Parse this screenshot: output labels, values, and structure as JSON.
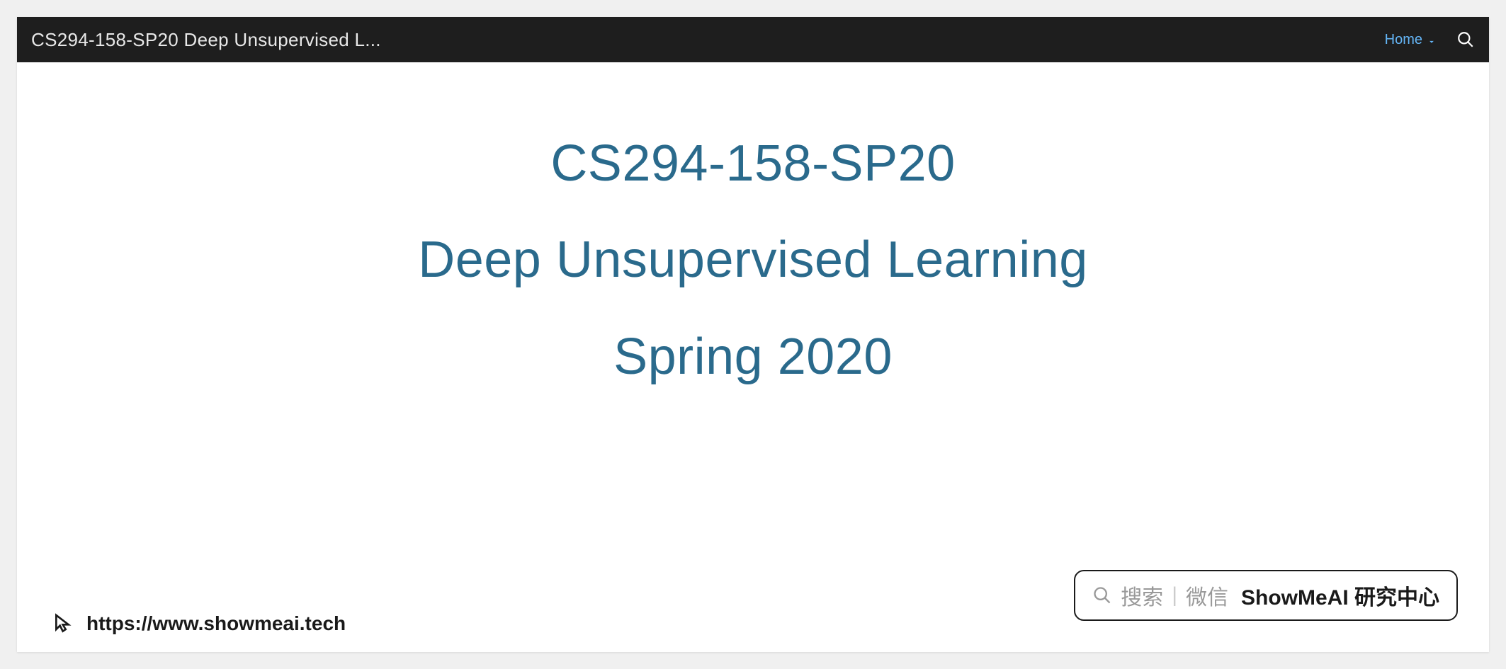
{
  "nav": {
    "title": "CS294-158-SP20 Deep Unsupervised L...",
    "home_label": "Home"
  },
  "hero": {
    "line1": "CS294-158-SP20",
    "line2": "Deep Unsupervised Learning",
    "line3": "Spring 2020"
  },
  "footer": {
    "url": "https://www.showmeai.tech"
  },
  "widget": {
    "search_label": "搜索",
    "platform_label": "微信",
    "brand": "ShowMeAI 研究中心"
  }
}
